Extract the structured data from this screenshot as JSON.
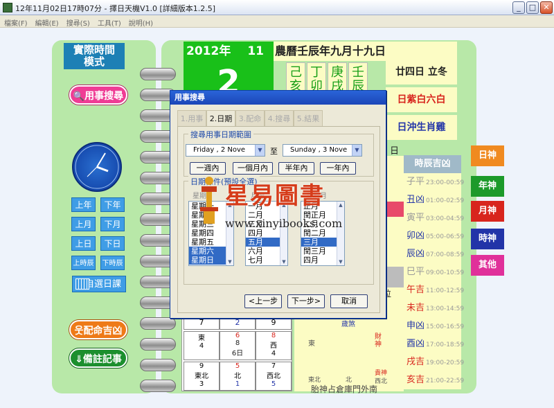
{
  "window": {
    "title": "12年11月02日17時07分 - 擇日天機V1.0 [詳細版本1.2.5]",
    "min": "_",
    "max": "□",
    "close": "✕"
  },
  "menu": [
    "檔案(F)",
    "編輯(E)",
    "搜尋(S)",
    "工具(T)",
    "說明(H)"
  ],
  "left": {
    "mode": "實際時間\n模式",
    "search_btn": "用事搜尋",
    "year_prev": "上年",
    "year_next": "下年",
    "month_prev": "上月",
    "month_next": "下月",
    "day_prev": "上日",
    "day_next": "下日",
    "hour_prev": "上時辰",
    "hour_next": "下時辰",
    "pick_date": "自選日課",
    "match_btn": "配命吉凶",
    "notes_btn": "備註記事"
  },
  "header": {
    "year": "2012年",
    "month": "11月",
    "lunar": "農曆壬辰年九月十九日",
    "day": "2",
    "ganzhi": [
      "己",
      "丁",
      "庚",
      "壬"
    ],
    "ganzhi_bottom": [
      "亥",
      "卯",
      "戌",
      "辰"
    ],
    "solar_term": "廿四日 立冬",
    "star": "日紫白六白",
    "clash": "日沖生肖雞"
  },
  "side_tabs": [
    {
      "label": "日神",
      "color": "#f08a20"
    },
    {
      "label": "年神",
      "color": "#1c9a2a"
    },
    {
      "label": "月神",
      "color": "#d8251d"
    },
    {
      "label": "時神",
      "color": "#2234a8"
    },
    {
      "label": "其他",
      "color": "#e0309a"
    }
  ],
  "hours": {
    "header": "時辰吉凶",
    "rows": [
      {
        "name": "子平",
        "time": "23:00-00:59",
        "color": "#999999"
      },
      {
        "name": "丑凶",
        "time": "01:00-02:59",
        "color": "#2234a8"
      },
      {
        "name": "寅平",
        "time": "03:00-04:59",
        "color": "#999999"
      },
      {
        "name": "卯凶",
        "time": "05:00-06:59",
        "color": "#2234a8"
      },
      {
        "name": "辰凶",
        "time": "07:00-08:59",
        "color": "#2234a8"
      },
      {
        "name": "巳平",
        "time": "09:00-10:59",
        "color": "#999999"
      },
      {
        "name": "午吉",
        "time": "11:00-12:59",
        "color": "#d8251d"
      },
      {
        "name": "未吉",
        "time": "13:00-14:59",
        "color": "#d8251d"
      },
      {
        "name": "申凶",
        "time": "15:00-16:59",
        "color": "#2234a8"
      },
      {
        "name": "酉凶",
        "time": "17:00-18:59",
        "color": "#2234a8"
      },
      {
        "name": "戌吉",
        "time": "19:00-20:59",
        "color": "#d8251d"
      },
      {
        "name": "亥吉",
        "time": "21:00-22:59",
        "color": "#d8251d"
      }
    ]
  },
  "jiri_labels": {
    "ri": "日",
    "wei": "位"
  },
  "grid": {
    "row1": [
      "7",
      "2",
      "9"
    ],
    "row2": [
      {
        "top": "東",
        "mid": "4",
        "bot": ""
      },
      {
        "top": "6",
        "mid": "8",
        "bot": "6日"
      },
      {
        "top": "8",
        "mid": "西",
        "bot": "4"
      }
    ],
    "row3": [
      {
        "top": "9",
        "mid": "東北",
        "bot": "3"
      },
      {
        "top": "5",
        "mid": "北",
        "bot": "1"
      },
      {
        "top": "7",
        "mid": "西北",
        "bot": "5"
      }
    ]
  },
  "lower": {
    "sha": "歲煞",
    "dong": "東",
    "cai": "財神",
    "dong_bei": "東北",
    "bei": "北",
    "gui": "貴神",
    "xi_bei": "西北",
    "tai": "胎神占倉庫門外南"
  },
  "dialog": {
    "title": "用事搜尋",
    "tabs": [
      "1.用事",
      "2.日期",
      "3.配命",
      "4.搜尋",
      "5.結果"
    ],
    "range_label": "搜尋用事日期範圍",
    "from": "Friday   ,   2 Nove",
    "to_label": "至",
    "to": "Sunday   ,   3 Nove",
    "quick": [
      "一週內",
      "一個月內",
      "半年內",
      "一年內"
    ],
    "cond_label": "日期條件(預設全選)",
    "sub1": "星期",
    "sub2": "月份",
    "sub3": "農曆月",
    "weekdays": [
      "星期一",
      "星期二",
      "星期三",
      "星期四",
      "星期五",
      "星期六",
      "星期日"
    ],
    "months": [
      "一月",
      "二月",
      "三月",
      "四月",
      "五月",
      "六月",
      "七月"
    ],
    "lunar_months": [
      "正月",
      "閏正月",
      "二月",
      "閏二月",
      "三月",
      "閏三月",
      "四月"
    ],
    "prev": "<上一步",
    "next": "下一步>",
    "cancel": "取消"
  },
  "watermark": {
    "cn": "星易圖書",
    "url": "www.xinyibooks.com"
  }
}
